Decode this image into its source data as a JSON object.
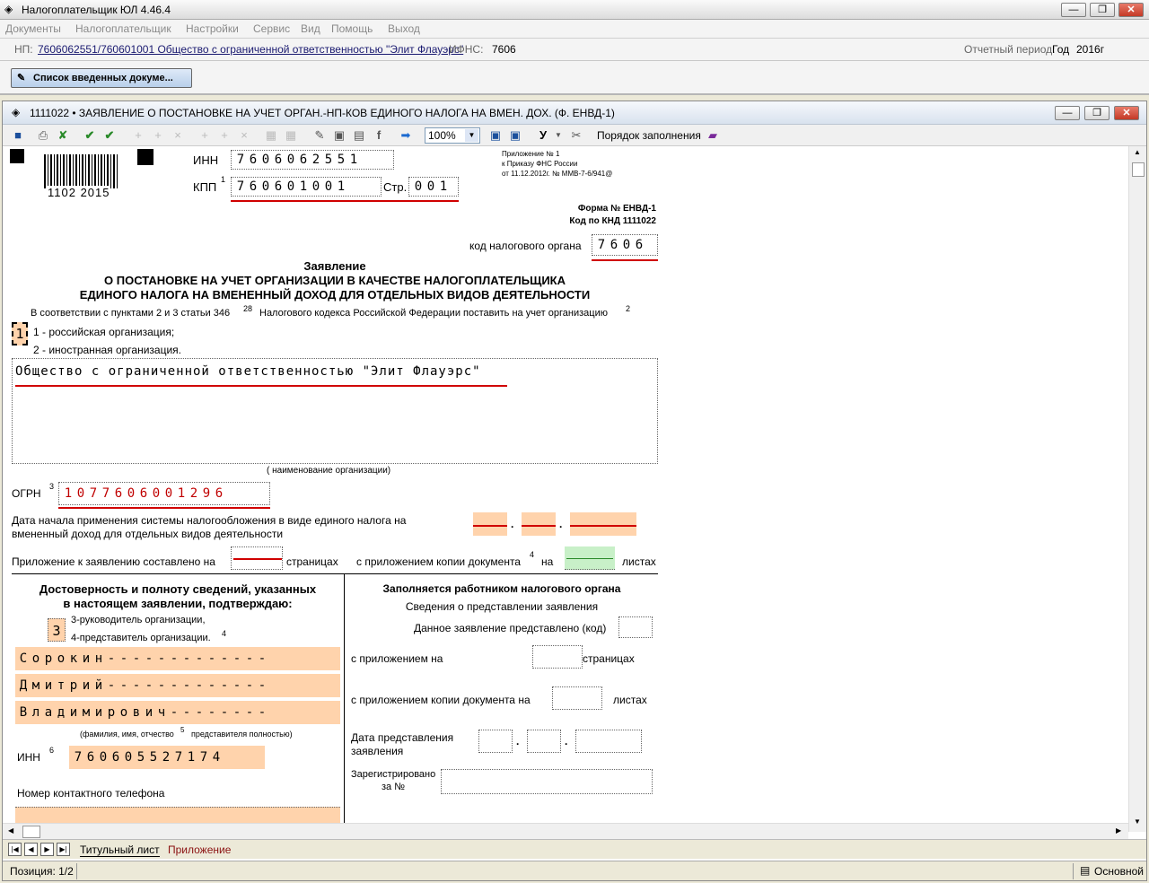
{
  "app": {
    "title": "Налогоплательщик ЮЛ 4.46.4"
  },
  "menu": [
    "Документы",
    "Налогоплательщик",
    "Настройки",
    "Сервис",
    "Вид",
    "Помощь",
    "Выход"
  ],
  "np": {
    "label": "НП:",
    "value": "7606062551/760601001 Общество с ограниченной ответственностью \"Элит Флауэрс\"",
    "ifns_label": "ИФНС:",
    "ifns": "7606",
    "period_label": "Отчетный период:",
    "period_type": "Год",
    "period_year": "2016г"
  },
  "list_button": "Список введенных докуме...",
  "doc": {
    "title": "1111022 • ЗАЯВЛЕНИЕ О ПОСТАНОВКЕ НА УЧЕТ ОРГАН.-НП-КОВ ЕДИНОГО НАЛОГА  НА ВМЕН. ДОХ.  (Ф. ЕНВД-1)"
  },
  "toolbar": {
    "zoom": "100%",
    "order_label": "Порядок заполнения",
    "u_label": "У"
  },
  "form": {
    "barcode_num": "1102 2015",
    "inn_label": "ИНН",
    "inn": [
      "7",
      "6",
      "0",
      "6",
      "0",
      "6",
      "2",
      "5",
      "5",
      "1"
    ],
    "kpp_label": "КПП",
    "kpp_sup": "1",
    "kpp": [
      "7",
      "6",
      "0",
      "6",
      "0",
      "1",
      "0",
      "0",
      "1"
    ],
    "page_label": "Стр.",
    "page": [
      "0",
      "0",
      "1"
    ],
    "appendix_l1": "Приложение № 1",
    "appendix_l2": "к Приказу ФНС России",
    "appendix_l3": "от 11.12.2012г. № ММВ-7-6/941@",
    "form_no": "Форма № ЕНВД-1",
    "knd": "Код по КНД 1111022",
    "tax_code_label": "код налогового органа",
    "tax_code": [
      "7",
      "6",
      "0",
      "6"
    ],
    "heading1": "Заявление",
    "heading2": "о постановке на учет организации в качестве налогоплательщика",
    "heading3": "единого налога на вмененный доход для отдельных видов деятельности",
    "basis_text": "В соответствии с пунктами 2 и 3 статьи 346",
    "basis_sup": "28",
    "basis_text2": "Налогового кодекса Российской Федерации поставить на учет организацию",
    "basis_sup2": "2",
    "org_type": "1",
    "org_opt1": "1 - российская организация;",
    "org_opt2": "2 - иностранная организация.",
    "org_name": "Общество с ограниченной ответственностью \"Элит Флауэрс\"",
    "org_name_caption": "( наименование организации)",
    "ogrn_label": "ОГРН",
    "ogrn_sup": "3",
    "ogrn": [
      "1",
      "0",
      "7",
      "7",
      "6",
      "0",
      "6",
      "0",
      "0",
      "1",
      "2",
      "9",
      "6"
    ],
    "start_date_label1": "Дата начала применения системы налогообложения в виде единого налога на",
    "start_date_label2": "вмененный доход для отдельных видов деятельности",
    "attach_label": "Приложение к заявлению составлено на",
    "attach_pages": "страницах",
    "attach_copy": "с приложением копии документа",
    "attach_sup": "4",
    "attach_on": "на",
    "attach_sheets": "листах",
    "confirm_h1": "Достоверность и полноту сведений, указанных",
    "confirm_h2": "в настоящем заявлении, подтверждаю:",
    "signer_code": "3",
    "signer_opt1": "3-руководитель организации,",
    "signer_opt2": "4-представитель организации.",
    "signer_sup": "4",
    "surname": [
      "С",
      "о",
      "р",
      "о",
      "к",
      "и",
      "н",
      "-",
      "-",
      "-",
      "-",
      "-",
      "-",
      "-",
      "-",
      "-",
      "-",
      "-",
      "-",
      "-"
    ],
    "firstname": [
      "Д",
      "м",
      "и",
      "т",
      "р",
      "и",
      "й",
      "-",
      "-",
      "-",
      "-",
      "-",
      "-",
      "-",
      "-",
      "-",
      "-",
      "-",
      "-",
      "-"
    ],
    "patronymic": [
      "В",
      "л",
      "а",
      "д",
      "и",
      "м",
      "и",
      "р",
      "о",
      "в",
      "и",
      "ч",
      "-",
      "-",
      "-",
      "-",
      "-",
      "-",
      "-",
      "-"
    ],
    "fio_caption": "(фамилия, имя, отчество",
    "fio_sup": "5",
    "fio_caption2": "представителя полностью)",
    "inn2_label": "ИНН",
    "inn2_sup": "6",
    "inn2": [
      "7",
      "6",
      "0",
      "6",
      "0",
      "5",
      "5",
      "2",
      "7",
      "1",
      "7",
      "4"
    ],
    "phone_label": "Номер контактного телефона",
    "office_h": "Заполняется работником налогового органа",
    "office_info": "Сведения о представлении заявления",
    "office_code": "Данное заявление представлено (код)",
    "office_attach": "с приложением на",
    "office_pages": "страницах",
    "office_copy": "с приложением копии  документа на",
    "office_sheets": "листах",
    "office_date1": "Дата представления",
    "office_date2": "заявления",
    "office_reg1": "Зарегистрировано",
    "office_reg2": "за №"
  },
  "tabs": [
    "Титульный лист",
    "Приложение"
  ],
  "status": {
    "position": "Позиция: 1/2",
    "mode": "Основной"
  },
  "colors": {
    "peach": "#ffd3ac",
    "green": "#c8f0c8",
    "red": "#d00000"
  }
}
